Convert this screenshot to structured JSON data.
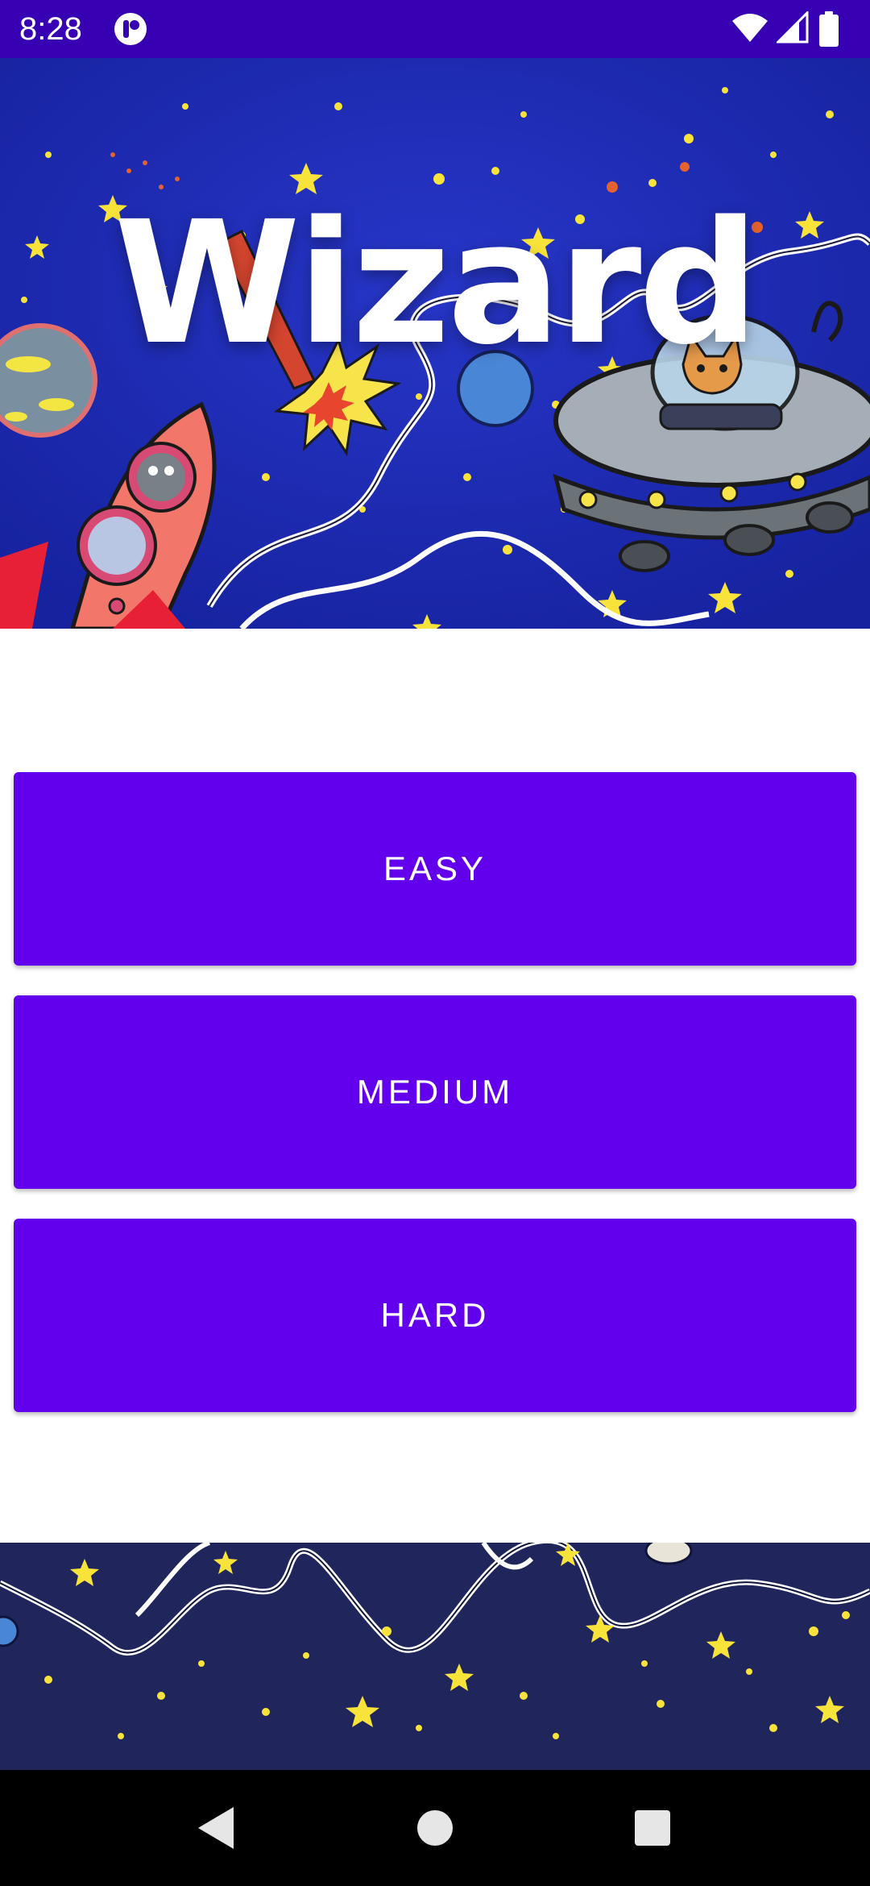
{
  "status_bar": {
    "time": "8:28",
    "icons": [
      "app-notification-icon",
      "wifi-icon",
      "cell-signal-icon",
      "battery-icon"
    ]
  },
  "hero": {
    "title": "Wizard"
  },
  "buttons": {
    "easy": "EASY",
    "medium": "MEDIUM",
    "hard": "HARD"
  },
  "nav_bar": {
    "icons": [
      "back-icon",
      "home-icon",
      "recents-icon"
    ]
  },
  "colors": {
    "status_bar": "#3700b3",
    "button": "#6200ee",
    "hero_background": "#1b2bb8",
    "bottom_art_background": "#20265c",
    "nav_bar": "#000000"
  }
}
